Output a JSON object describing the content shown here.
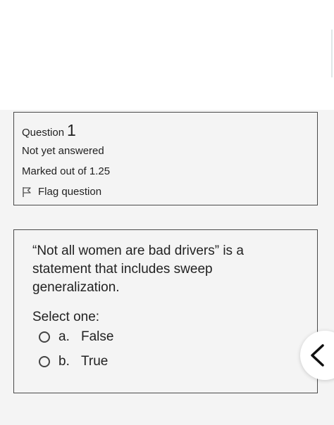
{
  "info": {
    "question_label": "Question",
    "question_number": "1",
    "status": "Not yet answered",
    "marks": "Marked out of 1.25",
    "flag_label": "Flag question"
  },
  "question": {
    "text": "“Not all women are bad drivers” is a statement that includes sweep generalization.",
    "prompt": "Select one:",
    "options": [
      {
        "letter": "a.",
        "label": "False"
      },
      {
        "letter": "b.",
        "label": "True"
      }
    ]
  },
  "icons": {
    "flag": "flag-icon",
    "radio": "radio-icon",
    "back": "chevron-left-icon"
  }
}
